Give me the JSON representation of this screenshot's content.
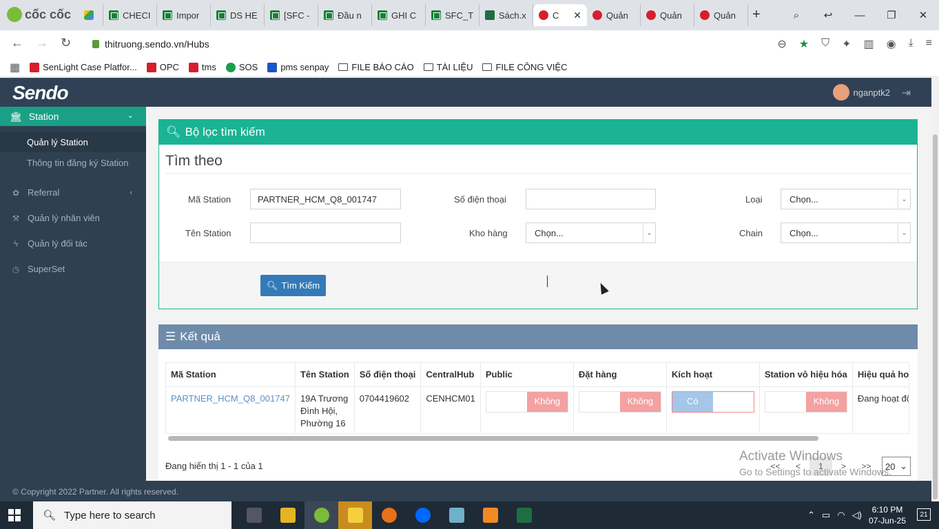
{
  "browser": {
    "brand": "cốc cốc",
    "tabs": [
      {
        "label": "",
        "icon": "drive-icon"
      },
      {
        "label": "CHECI",
        "icon": "sheets-icon"
      },
      {
        "label": "Impor",
        "icon": "sheets-icon"
      },
      {
        "label": "DS HE",
        "icon": "sheets-icon"
      },
      {
        "label": "[SFC -",
        "icon": "sheets-icon"
      },
      {
        "label": "Đầu n",
        "icon": "sheets-icon"
      },
      {
        "label": "GHI C",
        "icon": "sheets-icon"
      },
      {
        "label": "SFC_T",
        "icon": "sheets-icon"
      },
      {
        "label": "Sách.x",
        "icon": "excel-icon"
      },
      {
        "label": "C",
        "icon": "sendo-icon",
        "active": true
      },
      {
        "label": "Quản",
        "icon": "sendo-icon"
      },
      {
        "label": "Quản",
        "icon": "sendo-icon"
      },
      {
        "label": "Quản",
        "icon": "sendo-icon"
      }
    ],
    "url": "thitruong.sendo.vn/Hubs",
    "bookmarks": [
      {
        "label": "SenLight Case Platfor...",
        "icon": "sendo-icon"
      },
      {
        "label": "OPC",
        "icon": "sendo-icon"
      },
      {
        "label": "tms",
        "icon": "sendo-icon"
      },
      {
        "label": "SOS",
        "icon": "sos-icon"
      },
      {
        "label": "pms senpay",
        "icon": "pms-icon"
      },
      {
        "label": "FILE BÁO CÁO",
        "icon": "folder-icon"
      },
      {
        "label": "TÀI LIỆU",
        "icon": "folder-icon"
      },
      {
        "label": "FILE CÔNG VIỆC",
        "icon": "folder-icon"
      }
    ]
  },
  "header": {
    "logo": "Sendo",
    "username": "nganptk2"
  },
  "sidebar": {
    "active_section": "Station",
    "sub_items": [
      "Quản lý Station",
      "Thông tin đăng ký Station"
    ],
    "items": [
      {
        "label": "Referral",
        "icon": "gift-icon"
      },
      {
        "label": "Quản lý nhân viên",
        "icon": "wrench-icon"
      },
      {
        "label": "Quản lý đối tác",
        "icon": "bolt-icon"
      },
      {
        "label": "SuperSet",
        "icon": "history-icon"
      }
    ]
  },
  "filter": {
    "heading": "Bộ lọc tìm kiếm",
    "subheading": "Tìm theo",
    "fields": {
      "ma_station": {
        "label": "Mã Station",
        "value": "PARTNER_HCM_Q8_001747"
      },
      "ten_station": {
        "label": "Tên Station",
        "value": ""
      },
      "so_dien_thoai": {
        "label": "Số điện thoại",
        "value": ""
      },
      "kho_hang": {
        "label": "Kho hàng",
        "value": "Chọn..."
      },
      "loai": {
        "label": "Loại",
        "value": "Chọn..."
      },
      "chain": {
        "label": "Chain",
        "value": "Chọn..."
      }
    },
    "search_button": "Tìm Kiếm"
  },
  "results": {
    "heading": "Kết quả",
    "columns": [
      "Mã Station",
      "Tên Station",
      "Số điện thoại",
      "CentralHub",
      "Public",
      "Đặt hàng",
      "Kích hoạt",
      "Station vô hiệu hóa",
      "Hiệu quả hoạt"
    ],
    "rows": [
      {
        "ma_station": "PARTNER_HCM_Q8_001747",
        "ten_station_lines": [
          "19A Trương",
          "Đình Hội,",
          "Phường 16"
        ],
        "so_dien_thoai": "0704419602",
        "central_hub": "CENHCM01",
        "public": "Không",
        "dat_hang": "Không",
        "kich_hoat": "Có",
        "vo_hieu_hoa": "Không",
        "hieu_qua": "Đang hoạt động"
      }
    ],
    "showing": "Đang hiển thị 1 - 1 của 1",
    "pager": {
      "first": "<<",
      "prev": "<",
      "current": "1",
      "next": ">",
      "last": ">>",
      "page_size": "20"
    }
  },
  "watermark": {
    "line1": "Activate Windows",
    "line2": "Go to Settings to activate Windows."
  },
  "footer": {
    "copyright": "© Copyright 2022 Partner. All rights reserved."
  },
  "taskbar": {
    "search_placeholder": "Type here to search",
    "time": "6:10 PM",
    "date": "07-Jun-25",
    "notifications": "21"
  },
  "colors": {
    "sidebar": "#2f4050",
    "accent_teal": "#1ab394",
    "result_header": "#6e8ba9",
    "primary_button": "#337ab7",
    "toggle_no": "#f3a1a1",
    "toggle_yes": "#a5c6e8"
  }
}
